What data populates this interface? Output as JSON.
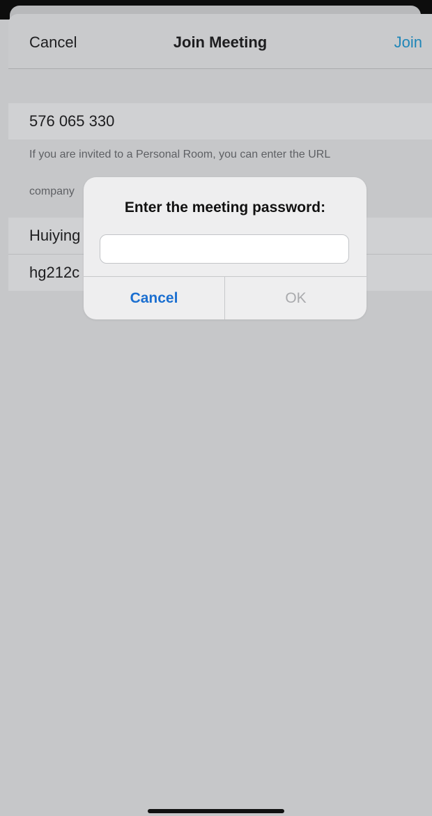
{
  "nav": {
    "cancel_label": "Cancel",
    "title": "Join Meeting",
    "join_label": "Join"
  },
  "form": {
    "meeting_number": "576 065 330",
    "hint_line1": "If you are invited to a Personal Room, you can enter the URL",
    "hint_line2": "company",
    "name_value": "Huiying",
    "email_value": "hg212c"
  },
  "dialog": {
    "title": "Enter the meeting password:",
    "password_value": "",
    "cancel_label": "Cancel",
    "ok_label": "OK"
  },
  "colors": {
    "accent": "#1f86b8",
    "dialog_button": "#1b6fd0",
    "disabled": "#a9aaad",
    "background": "#c6c7c9"
  }
}
